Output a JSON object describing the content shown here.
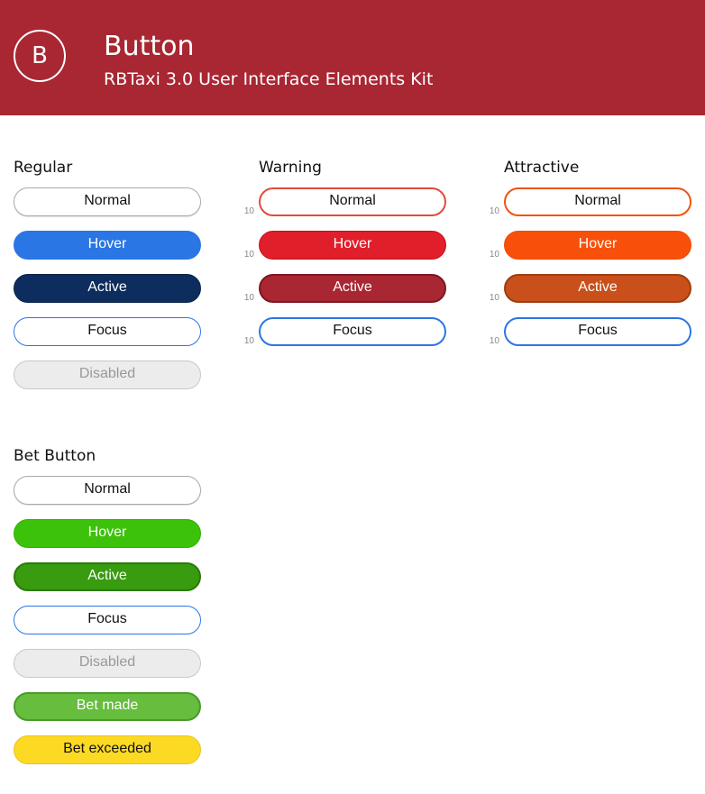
{
  "header": {
    "logo_letter": "B",
    "title": "Button",
    "subtitle": "RBTaxi 3.0 User Interface Elements Kit",
    "background_color": "#a82733"
  },
  "sections": {
    "regular": {
      "title": "Regular",
      "buttons": [
        "Normal",
        "Hover",
        "Active",
        "Focus",
        "Disabled"
      ]
    },
    "warning": {
      "title": "Warning",
      "buttons": [
        "Normal",
        "Hover",
        "Active",
        "Focus"
      ],
      "spacing_labels": [
        "10",
        "10",
        "10",
        "10"
      ]
    },
    "attractive": {
      "title": "Attractive",
      "buttons": [
        "Normal",
        "Hover",
        "Active",
        "Focus"
      ],
      "spacing_labels": [
        "10",
        "10",
        "10",
        "10"
      ]
    },
    "bet": {
      "title": "Bet Button",
      "buttons": [
        "Normal",
        "Hover",
        "Active",
        "Focus",
        "Disabled",
        "Bet made",
        "Bet exceeded"
      ]
    }
  },
  "colors": {
    "primary_blue": "#2a76e4",
    "navy": "#0d2d5e",
    "warning_red": "#e01f2b",
    "attractive_orange": "#f8500a",
    "bet_green": "#3cc20a",
    "bet_yellow": "#fcda24"
  }
}
